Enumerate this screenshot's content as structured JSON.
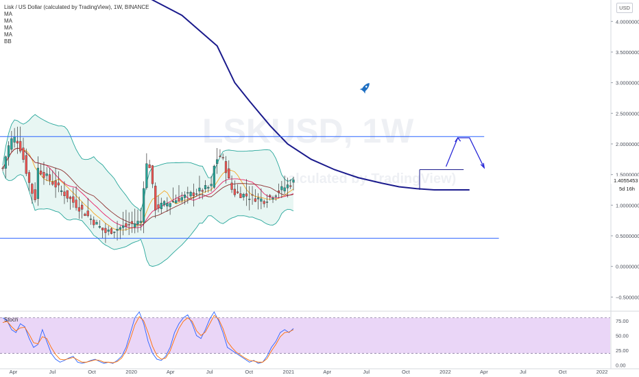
{
  "legend": {
    "title": "Lisk / US Dollar (calculated by TradingView), 1W, BINANCE",
    "indicators": [
      "MA",
      "MA",
      "MA",
      "MA",
      "BB"
    ]
  },
  "currency_button": "USD",
  "watermark": {
    "symbol": "LSKUSD, 1W",
    "subtitle": "Lisk / US Dollar (calculated by TradingView)"
  },
  "stoch_label": "Stoch",
  "chart_data": [
    {
      "type": "candlestick",
      "title": "Lisk / US Dollar (calculated by TradingView), 1W, BINANCE",
      "price_axis_ticks": [
        "4.0000000",
        "3.5000000",
        "3.0000000",
        "2.5000000",
        "2.0000000",
        "1.5000000",
        "1.0000000",
        "0.5000000",
        "0.0000000",
        "−0.5000000"
      ],
      "price_axis_values": [
        4.0,
        3.5,
        3.0,
        2.5,
        2.0,
        1.5,
        1.0,
        0.5,
        0.0,
        -0.5
      ],
      "ylim": [
        -0.72,
        4.35
      ],
      "time_axis_labels": [
        "Apr",
        "Jul",
        "Oct",
        "2020",
        "Apr",
        "Jul",
        "Oct",
        "2021",
        "Apr",
        "Jul",
        "Oct",
        "2022",
        "Apr",
        "Jul",
        "Oct",
        "2022"
      ],
      "time_axis_dates": [
        "2019-04-01",
        "2019-07-01",
        "2019-10-01",
        "2020-01-01",
        "2020-04-01",
        "2020-07-01",
        "2020-10-01",
        "2021-01-01",
        "2021-04-01",
        "2021-07-01",
        "2021-10-01",
        "2022-01-01",
        "2022-04-01",
        "2022-07-01",
        "2022-10-01",
        "2023-01-01"
      ],
      "xlim": [
        "2019-03-01",
        "2023-01-20"
      ],
      "last_price_label": "1.4055453",
      "last_price": 1.4055453,
      "countdown_label": "5d 16h",
      "grid": false,
      "colors": {
        "up": "#26a69a",
        "down": "#ef5350",
        "sma_long": "#1a1a8c",
        "ma_fast": "#f5a623",
        "ma_mid": "#e91e63",
        "bb_border": "#26a69a",
        "bb_fill": "#e8f6f3",
        "hlines": "#2962ff",
        "bb_basis": "#8d2f2f"
      },
      "sma_long": [
        [
          0.42,
          4.6
        ],
        [
          0.62,
          4.1
        ],
        [
          0.74,
          3.6
        ],
        [
          0.8,
          3.0
        ],
        [
          0.85,
          2.7
        ],
        [
          0.92,
          2.3
        ],
        [
          0.98,
          2.0
        ],
        [
          1.06,
          1.75
        ],
        [
          1.14,
          1.58
        ],
        [
          1.22,
          1.45
        ],
        [
          1.3,
          1.36
        ],
        [
          1.36,
          1.3
        ],
        [
          1.42,
          1.27
        ],
        [
          1.48,
          1.25
        ],
        [
          1.55,
          1.25
        ],
        [
          1.6,
          1.25
        ]
      ],
      "horizontal_lines": [
        {
          "y": 2.12,
          "x": [
            0.0,
            1.65
          ]
        },
        {
          "y": 0.46,
          "x": [
            0.0,
            1.7
          ]
        },
        {
          "y": 1.58,
          "x": [
            1.43,
            1.58
          ]
        }
      ],
      "annotation_arrow": [
        [
          1.52,
          1.63
        ],
        [
          1.56,
          2.1
        ],
        [
          1.6,
          2.1
        ],
        [
          1.65,
          1.61
        ]
      ],
      "rocket_marker": {
        "x": 1.65,
        "y": 2.9
      }
    },
    {
      "type": "line",
      "title": "Stoch",
      "y_ticks": [
        "75.00",
        "50.00",
        "25.00",
        "0.00"
      ],
      "y_values": [
        75,
        50,
        25,
        0
      ],
      "ylim": [
        -5,
        90
      ],
      "band": [
        20,
        80
      ],
      "series": [
        {
          "values": [
            80,
            75,
            60,
            55,
            70,
            65,
            45,
            30,
            35,
            60,
            40,
            20,
            10,
            5,
            8,
            12,
            15,
            5,
            3,
            5,
            8,
            10,
            6,
            3,
            5,
            3,
            8,
            15,
            30,
            55,
            80,
            90,
            70,
            40,
            20,
            10,
            8,
            15,
            30,
            55,
            70,
            80,
            85,
            70,
            50,
            45,
            60,
            78,
            90,
            75,
            55,
            30,
            25,
            20,
            15,
            10,
            5,
            8,
            3,
            5,
            15,
            30,
            40,
            55,
            60,
            55,
            62
          ]
        },
        {
          "values": [
            72,
            74,
            65,
            58,
            63,
            64,
            52,
            38,
            36,
            48,
            45,
            30,
            18,
            10,
            9,
            11,
            13,
            9,
            5,
            5,
            7,
            9,
            8,
            5,
            5,
            4,
            6,
            12,
            24,
            45,
            68,
            82,
            75,
            55,
            32,
            16,
            10,
            12,
            24,
            44,
            62,
            74,
            80,
            74,
            58,
            50,
            56,
            70,
            84,
            78,
            62,
            40,
            30,
            22,
            17,
            12,
            8,
            7,
            5,
            5,
            11,
            24,
            35,
            48,
            55,
            56,
            60
          ]
        }
      ]
    }
  ]
}
